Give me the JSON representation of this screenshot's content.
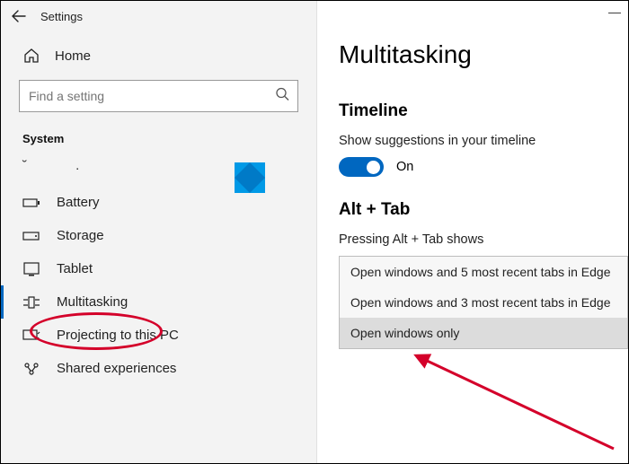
{
  "titlebar": {
    "title": "Settings"
  },
  "sidebar": {
    "home_label": "Home",
    "search_placeholder": "Find a setting",
    "section": "System",
    "items": [
      {
        "label": "Battery"
      },
      {
        "label": "Storage"
      },
      {
        "label": "Tablet"
      },
      {
        "label": "Multitasking"
      },
      {
        "label": "Projecting to this PC"
      },
      {
        "label": "Shared experiences"
      }
    ]
  },
  "main": {
    "heading": "Multitasking",
    "timeline": {
      "title": "Timeline",
      "label": "Show suggestions in your timeline",
      "toggle_state": "On"
    },
    "alttab": {
      "title": "Alt + Tab",
      "label": "Pressing Alt + Tab shows",
      "options": [
        "Open windows and 5 most recent tabs in Edge",
        "Open windows and 3 most recent tabs in Edge",
        "Open windows only"
      ]
    }
  }
}
